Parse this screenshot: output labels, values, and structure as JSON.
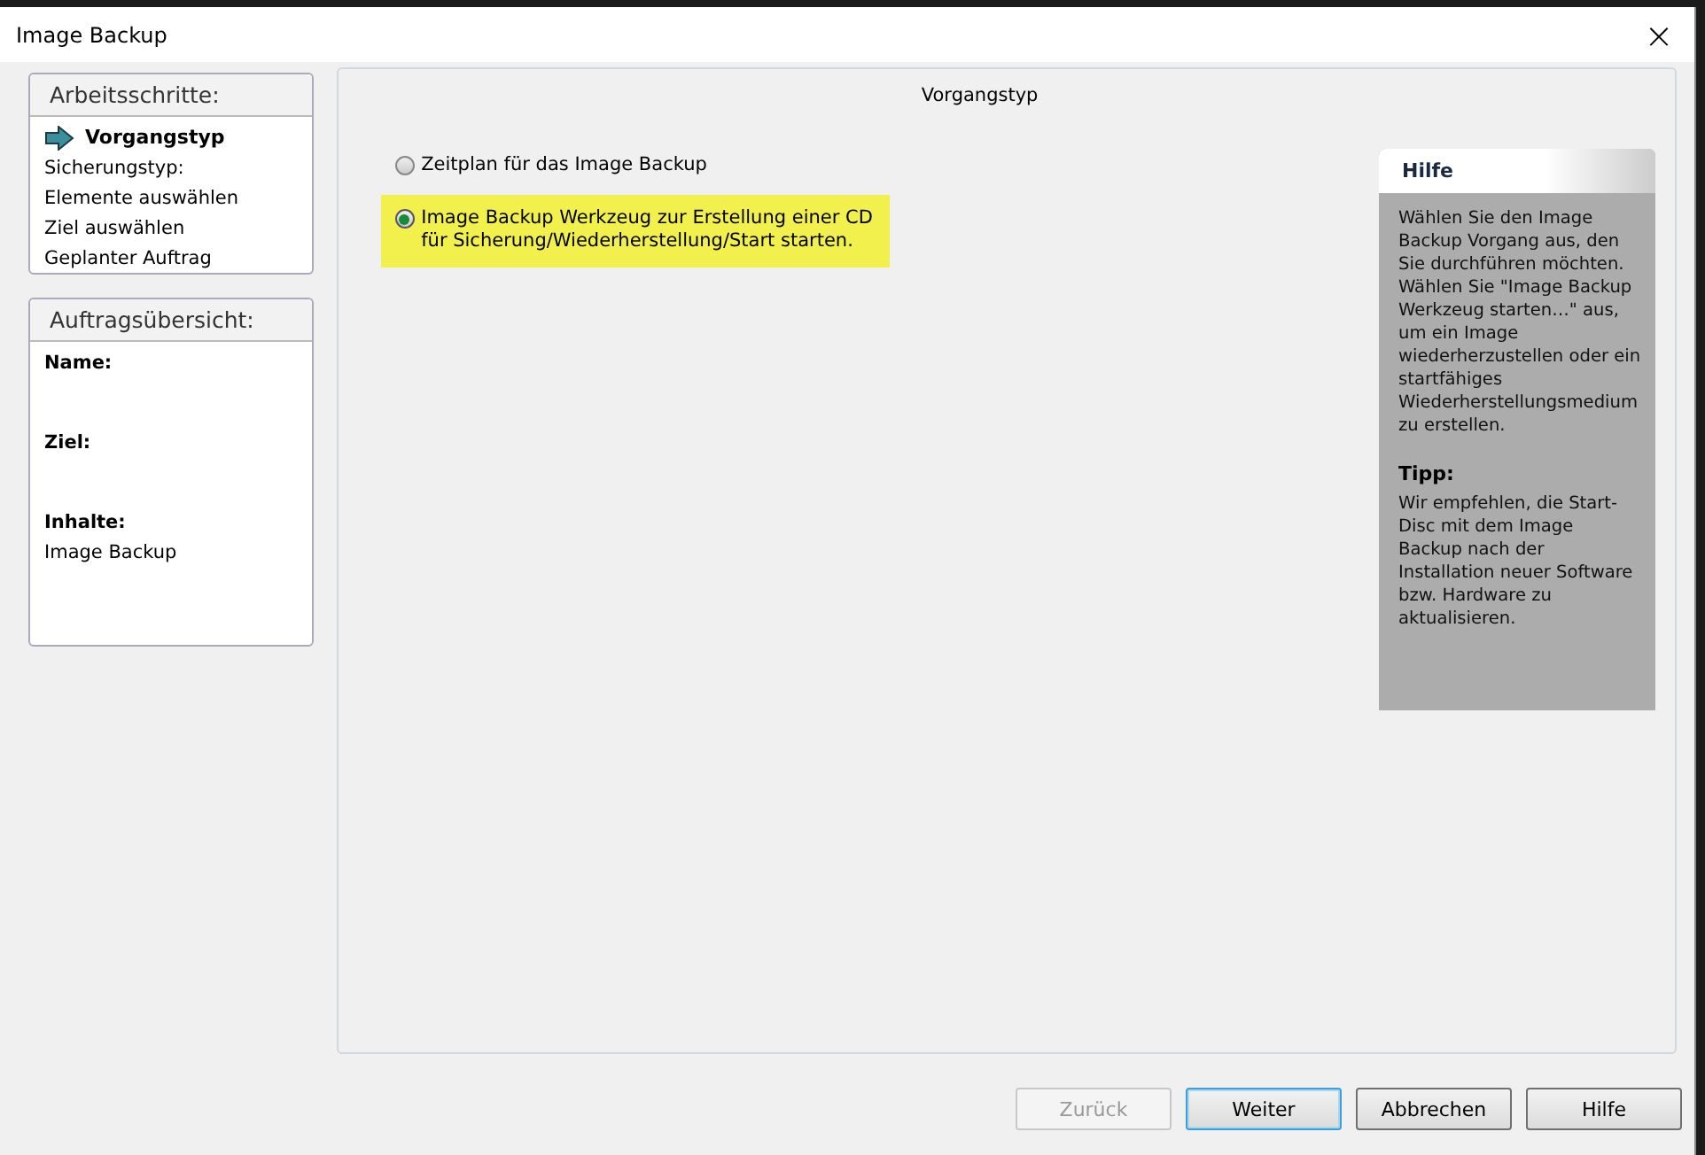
{
  "window": {
    "title": "Image Backup",
    "close": "×"
  },
  "steps": {
    "title": "Arbeitsschritte:",
    "items": [
      {
        "label": "Vorgangstyp",
        "selected": true
      },
      {
        "label": "Sicherungstyp:",
        "selected": false
      },
      {
        "label": "Elemente auswählen",
        "selected": false
      },
      {
        "label": "Ziel auswählen",
        "selected": false
      },
      {
        "label": "Geplanter Auftrag",
        "selected": false
      }
    ]
  },
  "summary": {
    "title": "Auftragsübersicht:",
    "fields": [
      {
        "label": "Name:"
      },
      {
        "label": "Ziel:"
      },
      {
        "label": "Inhalte:",
        "value": "Image Backup"
      }
    ]
  },
  "main": {
    "heading": "Vorgangstyp",
    "options": [
      {
        "label": "Zeitplan für das Image Backup",
        "selected": false
      },
      {
        "label": "Image Backup Werkzeug zur Erstellung einer CD für Sicherung/Wiederherstellung/Start starten.",
        "selected": true
      }
    ]
  },
  "help": {
    "title": "Hilfe",
    "text": "Wählen Sie den Image Backup Vorgang aus, den Sie durchführen möchten. Wählen Sie \"Image Backup Werkzeug starten…\" aus, um ein Image wiederherzustellen oder ein startfähiges Wiederherstellungsmedium zu erstellen.",
    "tip_title": "Tipp:",
    "tip_text": "Wir empfehlen, die Start-Disc mit dem Image Backup nach der Installation neuer Software bzw. Hardware zu aktualisieren."
  },
  "buttons": [
    {
      "label": "Zurück",
      "disabled": true,
      "default": false
    },
    {
      "label": "Weiter",
      "disabled": false,
      "default": true
    },
    {
      "label": "Abbrechen",
      "disabled": false,
      "default": false
    },
    {
      "label": "Hilfe",
      "disabled": false,
      "default": false
    }
  ]
}
